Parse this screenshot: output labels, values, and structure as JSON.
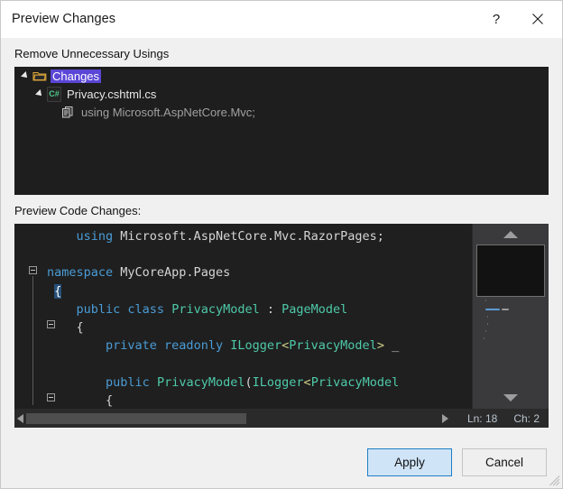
{
  "window": {
    "title": "Preview Changes",
    "help_icon": "question-mark-icon",
    "help_label": "?",
    "close_icon": "close-icon"
  },
  "tree_section": {
    "label": "Remove Unnecessary Usings",
    "items": [
      {
        "label": "Changes",
        "icon": "folder-icon",
        "depth": 0,
        "expanded": true,
        "selected": true
      },
      {
        "label": "Privacy.cshtml.cs",
        "icon": "csharp-file-icon",
        "icon_text": "C#",
        "depth": 1,
        "expanded": true,
        "selected": false
      },
      {
        "label": "using Microsoft.AspNetCore.Mvc;",
        "icon": "using-directive-icon",
        "depth": 2,
        "expanded": false,
        "selected": false
      }
    ]
  },
  "code_section": {
    "label": "Preview Code Changes:",
    "lines": [
      [
        {
          "t": "    ",
          "c": "pun"
        },
        {
          "t": "using",
          "c": "kw"
        },
        {
          "t": " Microsoft.AspNetCore.Mvc.RazorPages;",
          "c": "id"
        }
      ],
      [],
      [
        {
          "t": "namespace",
          "c": "kw"
        },
        {
          "t": " MyCoreApp.Pages",
          "c": "id"
        }
      ],
      [
        {
          "t": " ",
          "c": "pun"
        },
        {
          "t": "{",
          "c": "sel"
        }
      ],
      [
        {
          "t": "    ",
          "c": "pun"
        },
        {
          "t": "public class",
          "c": "kw"
        },
        {
          "t": " ",
          "c": "pun"
        },
        {
          "t": "PrivacyModel",
          "c": "typ"
        },
        {
          "t": " : ",
          "c": "pun"
        },
        {
          "t": "PageModel",
          "c": "typ"
        }
      ],
      [
        {
          "t": "    {",
          "c": "pun"
        }
      ],
      [
        {
          "t": "        ",
          "c": "pun"
        },
        {
          "t": "private readonly",
          "c": "kw"
        },
        {
          "t": " ",
          "c": "pun"
        },
        {
          "t": "ILogger",
          "c": "typ"
        },
        {
          "t": "<",
          "c": "ang"
        },
        {
          "t": "PrivacyModel",
          "c": "typ"
        },
        {
          "t": ">",
          "c": "ang"
        },
        {
          "t": " _",
          "c": "id"
        }
      ],
      [],
      [
        {
          "t": "        ",
          "c": "pun"
        },
        {
          "t": "public",
          "c": "kw"
        },
        {
          "t": " ",
          "c": "pun"
        },
        {
          "t": "PrivacyModel",
          "c": "typ"
        },
        {
          "t": "(",
          "c": "pun"
        },
        {
          "t": "ILogger",
          "c": "typ"
        },
        {
          "t": "<",
          "c": "ang"
        },
        {
          "t": "PrivacyModel",
          "c": "typ"
        }
      ],
      [
        {
          "t": "        {",
          "c": "pun"
        }
      ]
    ],
    "status": {
      "line_label": "Ln: 18",
      "column_label": "Ch: 2"
    },
    "scroll": {
      "left_arrow_icon": "scroll-left-arrow-icon",
      "right_arrow_icon": "scroll-right-arrow-icon",
      "up_arrow_icon": "scroll-up-arrow-icon",
      "down_arrow_icon": "scroll-down-arrow-icon"
    }
  },
  "footer": {
    "apply_label": "Apply",
    "cancel_label": "Cancel"
  },
  "colors": {
    "accent": "#1f7ec4",
    "selection": "#5a46d6",
    "code_bg": "#1f1f1f",
    "tree_bg": "#1e1e1e",
    "keyword": "#4a9cd6",
    "type": "#4ec9a8",
    "dialog_bg": "#f0f0f0"
  }
}
